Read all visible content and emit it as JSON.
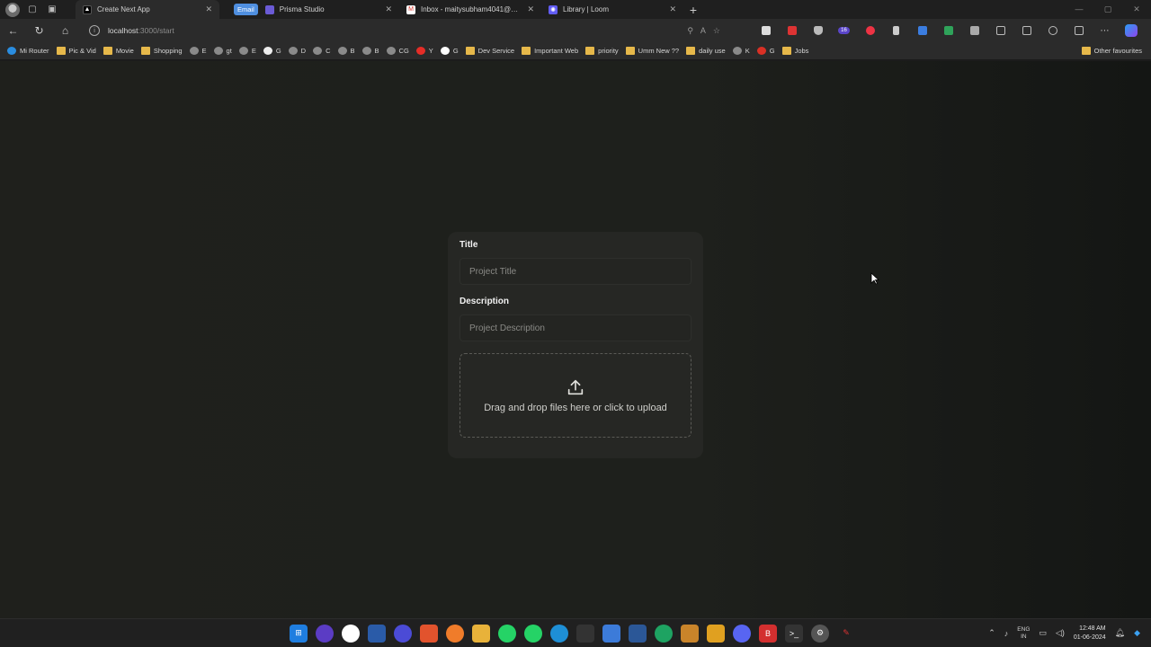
{
  "browser": {
    "tabs": [
      {
        "title": "Create Next App",
        "active": true,
        "icon": "nextjs-icon"
      },
      {
        "title": "Prisma Studio",
        "active": false,
        "icon": "prisma-icon",
        "chip": "Email"
      },
      {
        "title": "Inbox - maitysubham4041@gm...",
        "active": false,
        "icon": "gmail-icon"
      },
      {
        "title": "Library | Loom",
        "active": false,
        "icon": "loom-icon"
      }
    ],
    "url_host": "localhost",
    "url_path": ":3000/start",
    "extension_badge": "16",
    "bookmarks": [
      {
        "label": "Mi Router",
        "icon": "router"
      },
      {
        "label": "Pic & Vid",
        "icon": "folder"
      },
      {
        "label": "Movie",
        "icon": "folder"
      },
      {
        "label": "Shopping",
        "icon": "folder"
      },
      {
        "label": "E",
        "icon": "site"
      },
      {
        "label": "gt",
        "icon": "site"
      },
      {
        "label": "E",
        "icon": "site"
      },
      {
        "label": "G",
        "icon": "github"
      },
      {
        "label": "D",
        "icon": "site"
      },
      {
        "label": "C",
        "icon": "site"
      },
      {
        "label": "B",
        "icon": "site"
      },
      {
        "label": "B",
        "icon": "site"
      },
      {
        "label": "CG",
        "icon": "site"
      },
      {
        "label": "Y",
        "icon": "youtube"
      },
      {
        "label": "G",
        "icon": "google"
      },
      {
        "label": "Dev Service",
        "icon": "folder"
      },
      {
        "label": "Important Web",
        "icon": "folder"
      },
      {
        "label": "priority",
        "icon": "folder"
      },
      {
        "label": "Umm New ??",
        "icon": "folder"
      },
      {
        "label": "daily use",
        "icon": "folder"
      },
      {
        "label": "K",
        "icon": "site"
      },
      {
        "label": "G",
        "icon": "gmail"
      },
      {
        "label": "Jobs",
        "icon": "folder"
      }
    ],
    "other_bookmarks": "Other favourites"
  },
  "form": {
    "title_label": "Title",
    "title_placeholder": "Project Title",
    "description_label": "Description",
    "description_placeholder": "Project Description",
    "upload_text": "Drag and drop files here or click to upload"
  },
  "taskbar": {
    "lang_line1": "ENG",
    "lang_line2": "IN",
    "time": "12:48 AM",
    "date": "01-06-2024"
  },
  "colors": {
    "page_bg": "#1f201c",
    "card_bg": "#262724",
    "accent_chip": "#4f8fe0"
  }
}
